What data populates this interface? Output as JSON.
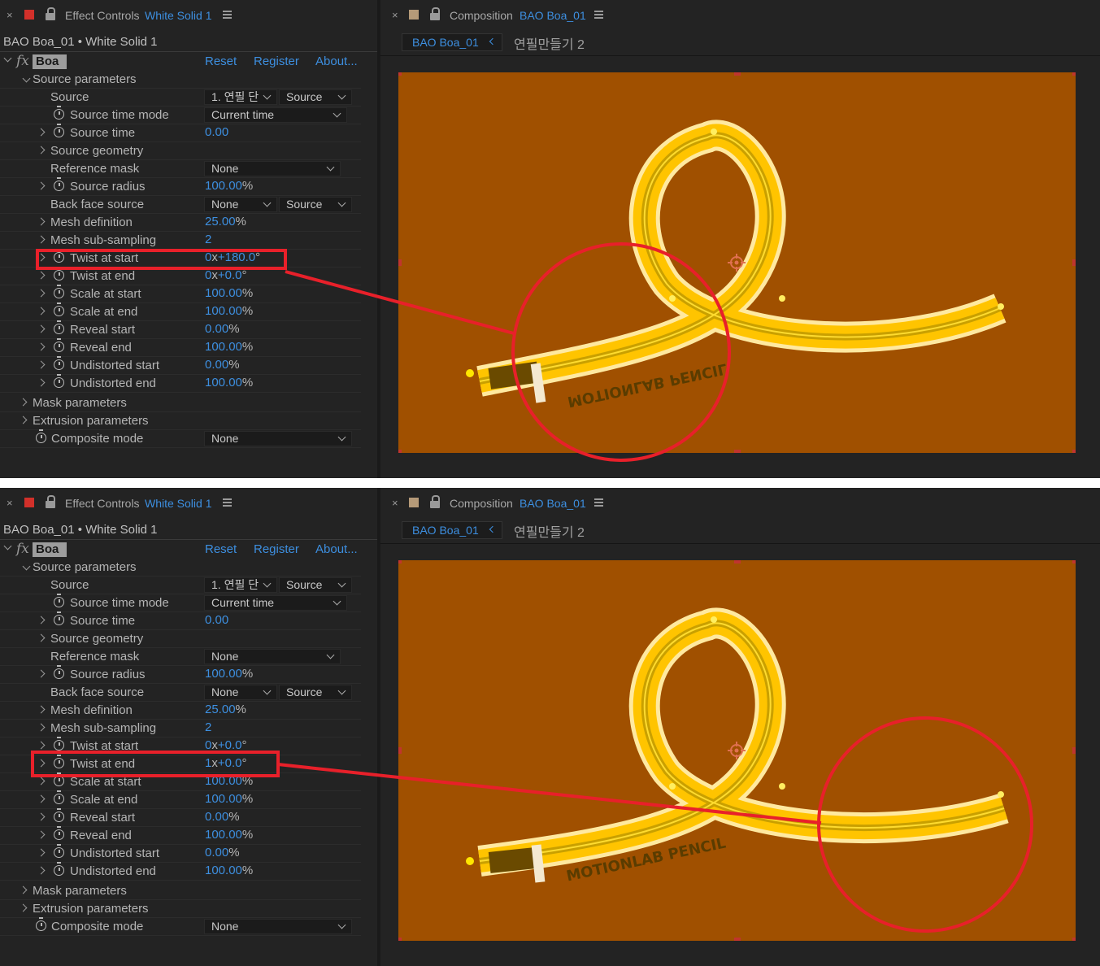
{
  "effect_controls": {
    "panel_title": "Effect Controls",
    "panel_layer": "White Solid 1",
    "layer_path": "BAO Boa_01 • White Solid 1",
    "effect": {
      "fx": "fx",
      "name": "Boa",
      "reset": "Reset",
      "register": "Register",
      "about": "About..."
    },
    "source_parameters": "Source parameters",
    "source": {
      "label": "Source",
      "layer_value": "1. 연필 단",
      "mode_value": "Source"
    },
    "source_time_mode": {
      "label": "Source time mode",
      "value": "Current time"
    },
    "source_time": {
      "label": "Source time",
      "value": "0.00"
    },
    "source_geometry": {
      "label": "Source geometry"
    },
    "reference_mask": {
      "label": "Reference mask",
      "value": "None"
    },
    "source_radius": {
      "label": "Source radius",
      "value": "100.00",
      "unit": "%"
    },
    "back_face_source": {
      "label": "Back face source",
      "value1": "None",
      "value2": "Source"
    },
    "mesh_definition": {
      "label": "Mesh definition",
      "value": "25.00",
      "unit": "%"
    },
    "mesh_sub_sampling": {
      "label": "Mesh sub-sampling",
      "value": "2"
    },
    "twist_at_start": {
      "label": "Twist at start"
    },
    "twist_at_end": {
      "label": "Twist at end"
    },
    "scale_at_start": {
      "label": "Scale at start",
      "value": "100.00",
      "unit": "%"
    },
    "scale_at_end": {
      "label": "Scale at end",
      "value": "100.00",
      "unit": "%"
    },
    "reveal_start": {
      "label": "Reveal start",
      "value": "0.00",
      "unit": "%"
    },
    "reveal_end": {
      "label": "Reveal end",
      "value": "100.00",
      "unit": "%"
    },
    "undistorted_start": {
      "label": "Undistorted start",
      "value": "0.00",
      "unit": "%"
    },
    "undistorted_end": {
      "label": "Undistorted end",
      "value": "100.00",
      "unit": "%"
    },
    "mask_parameters": "Mask parameters",
    "extrusion_parameters": "Extrusion parameters",
    "composite_mode": {
      "label": "Composite mode",
      "value": "None"
    }
  },
  "composition": {
    "panel_title": "Composition",
    "panel_comp": "BAO Boa_01",
    "tab_active": "BAO Boa_01",
    "tab_other": "연필만들기 2",
    "pencil_text": "MOTIONLAB PENCIL",
    "background_color": "#a05000",
    "pencil_color": "#ffcc00"
  },
  "panels": {
    "top": {
      "twist_at_start": {
        "turns": "0",
        "x": "x",
        "degrees": "+180.0",
        "deg": "°"
      },
      "twist_at_end": {
        "turns": "0",
        "x": "x",
        "degrees": "+0.0",
        "deg": "°"
      }
    },
    "bottom": {
      "twist_at_start": {
        "turns": "0",
        "x": "x",
        "degrees": "+0.0",
        "deg": "°"
      },
      "twist_at_end": {
        "turns": "1",
        "x": "x",
        "degrees": "+0.0",
        "deg": "°"
      }
    }
  },
  "annotation": {
    "color": "#e8202a"
  },
  "icons": [
    "close-icon",
    "color-swatch-icon",
    "lock-icon",
    "panel-menu-icon",
    "chevron-down-icon",
    "chevron-right-icon",
    "stopwatch-icon",
    "anchor-crosshair-icon"
  ]
}
